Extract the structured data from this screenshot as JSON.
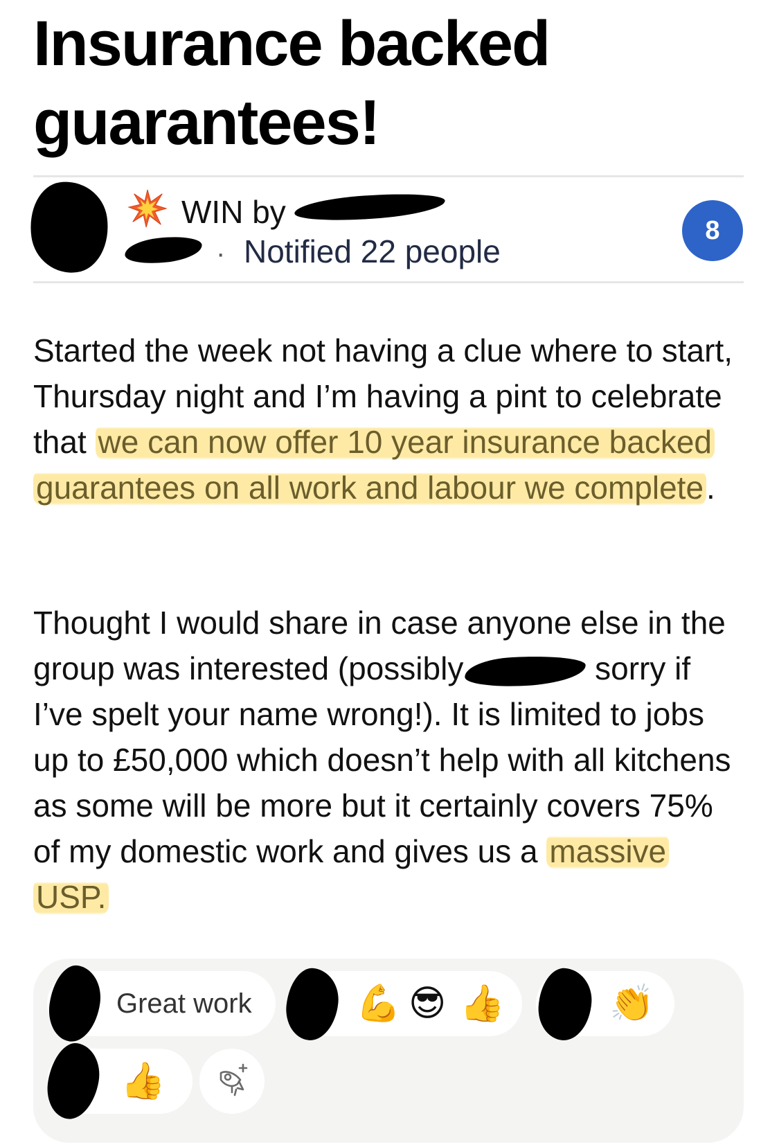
{
  "post": {
    "title": "Insurance backed guarantees!",
    "post_type": "WIN by",
    "post_type_icon": "collision-burst-icon",
    "separator": "·",
    "notified": "Notified 22 people",
    "comment_count": "8"
  },
  "body": {
    "p1_before": "Started the week not having a clue where to start, Thursday night and I’m having a pint to celebrate that ",
    "p1_highlight": "we can now offer 10 year insurance backed guarantees on all work and labour we complete",
    "p1_after": ".",
    "p2_text_1": "Thought I would share in case anyone else in the group was interested (possibly",
    "p2_text_2": " sorry if I’ve spelt your name wrong!). It is limited to jobs up to £50,000 which doesn’t help with all kitchens as some will be more but it certainly covers 75% of my domestic work and gives us a ",
    "p2_highlight": "massive USP.",
    "highlight_color": "#fde282",
    "badge_color": "#2e64c8"
  },
  "reactions": {
    "r1_text": "Great work",
    "r2_emoji_1": "💪",
    "r2_emoji_2": "😎",
    "r2_emoji_3": "👍",
    "r3_emoji_1": "👏",
    "r4_emoji_1": "👍",
    "add_reaction_icon": "rocket-plus-icon"
  }
}
